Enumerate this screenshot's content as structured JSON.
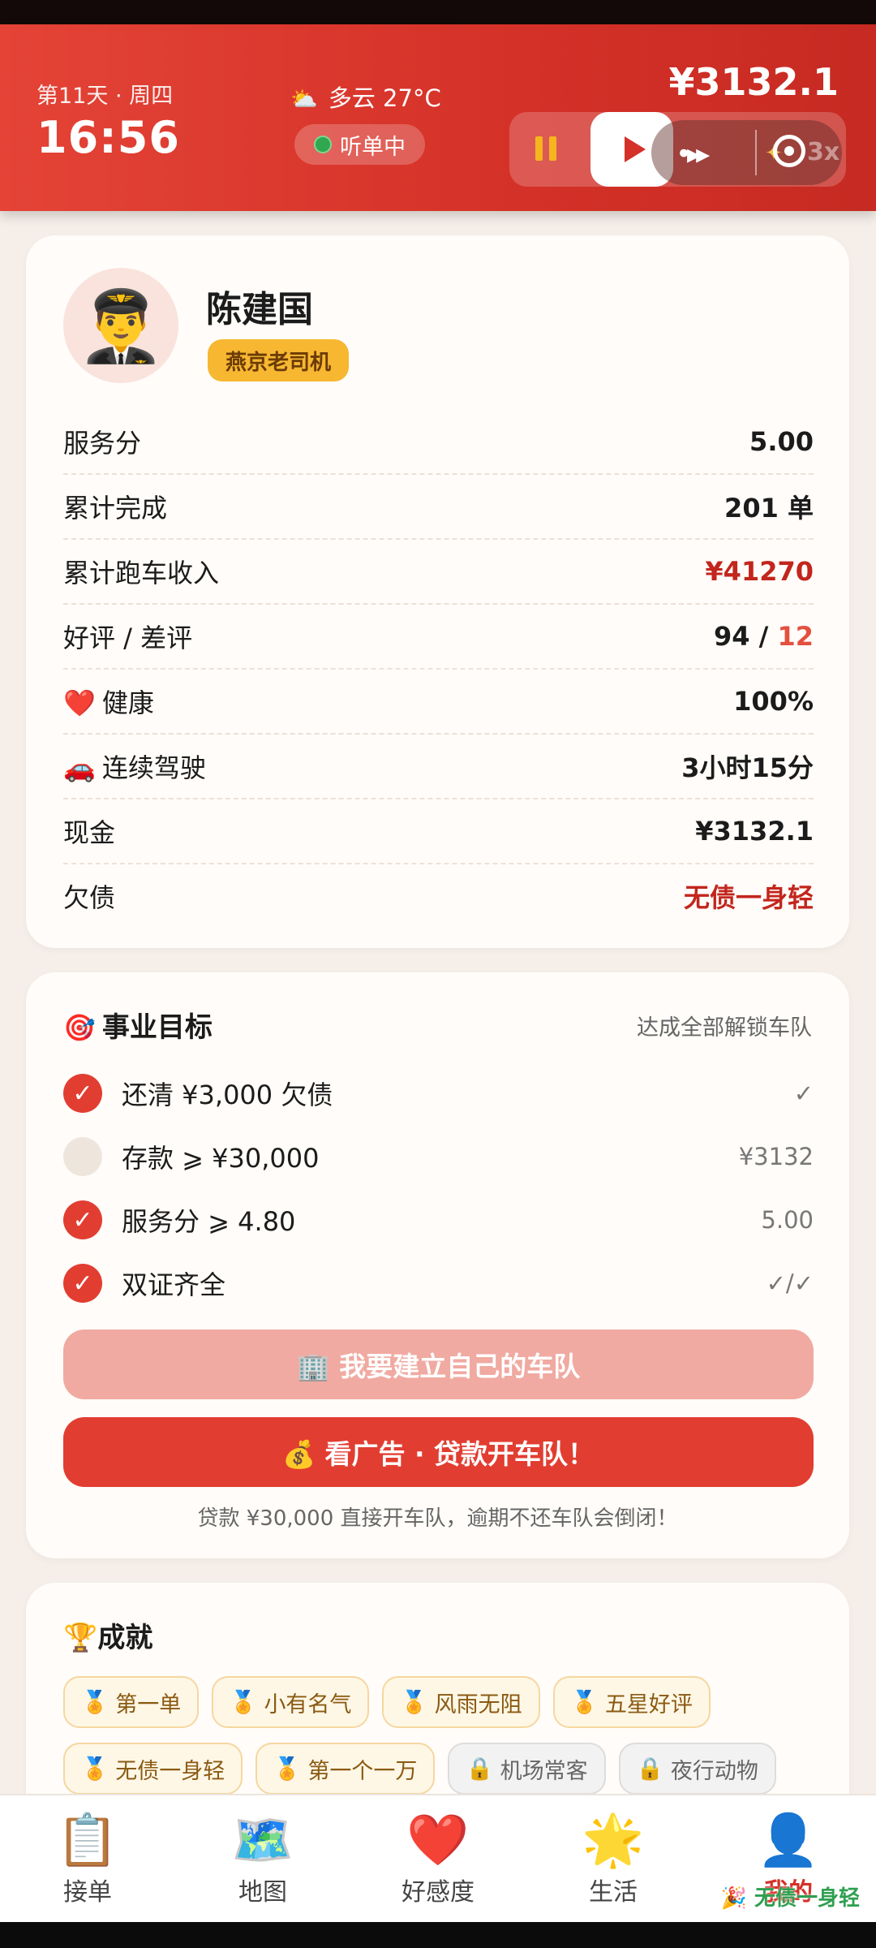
{
  "header": {
    "day": "第11天 · 周四",
    "time": "16:56",
    "weather_icon": "⛅",
    "weather": "多云 27°C",
    "listen_status": "听单中",
    "cash": "¥3132.1",
    "speed_label": "3x"
  },
  "profile": {
    "avatar_icon": "👨‍✈️",
    "name": "陈建国",
    "title": "燕京老司机",
    "stats": [
      {
        "label": "服务分",
        "value": "5.00"
      },
      {
        "label": "累计完成",
        "value": "201 单"
      },
      {
        "label": "累计跑车收入",
        "value": "¥41270"
      },
      {
        "label": "好评 / 差评",
        "good": "94",
        "sep": " / ",
        "bad": "12"
      },
      {
        "icon": "❤️",
        "label": "健康",
        "value": "100%"
      },
      {
        "icon": "🚗",
        "label": "连续驾驶",
        "value": "3小时15分"
      },
      {
        "label": "现金",
        "value": "¥3132.1"
      },
      {
        "label": "欠债",
        "value": "无债一身轻"
      }
    ]
  },
  "goals": {
    "icon": "🎯",
    "title": "事业目标",
    "hint": "达成全部解锁车队",
    "items": [
      {
        "label": "还清 ¥3,000 欠债",
        "value": "✓",
        "done": true
      },
      {
        "label": "存款 ⩾ ¥30,000",
        "value": "¥3132",
        "done": false
      },
      {
        "label": "服务分 ⩾ 4.80",
        "value": "5.00",
        "done": true
      },
      {
        "label": "双证齐全",
        "value": "✓/✓",
        "done": true
      }
    ],
    "check_mark": "✓",
    "fleet_button": "🏢 我要建立自己的车队",
    "loan_button": "💰 看广告 · 贷款开车队！",
    "loan_note": "贷款 ¥30,000 直接开车队，逾期不还车队会倒闭！"
  },
  "achievements": {
    "icon": "🏆",
    "title": "成就",
    "badges": [
      {
        "icon": "🏅",
        "label": "第一单",
        "locked": false
      },
      {
        "icon": "🏅",
        "label": "小有名气",
        "locked": false
      },
      {
        "icon": "🏅",
        "label": "风雨无阻",
        "locked": false
      },
      {
        "icon": "🏅",
        "label": "五星好评",
        "locked": false
      },
      {
        "icon": "🏅",
        "label": "无债一身轻",
        "locked": false
      },
      {
        "icon": "🏅",
        "label": "第一个一万",
        "locked": false
      },
      {
        "icon": "🔒",
        "label": "机场常客",
        "locked": true
      },
      {
        "icon": "🔒",
        "label": "夜行动物",
        "locked": true
      }
    ]
  },
  "tabs": [
    {
      "icon": "📋",
      "label": "接单"
    },
    {
      "icon": "🗺️",
      "label": "地图"
    },
    {
      "icon": "❤️",
      "label": "好感度"
    },
    {
      "icon": "🌟",
      "label": "生活"
    },
    {
      "icon": "👤",
      "label": "我的"
    }
  ],
  "toast": "🎉 无债一身轻",
  "colors": {
    "accent": "#e23d31",
    "header": "#d43128",
    "gold": "#f7b731"
  }
}
